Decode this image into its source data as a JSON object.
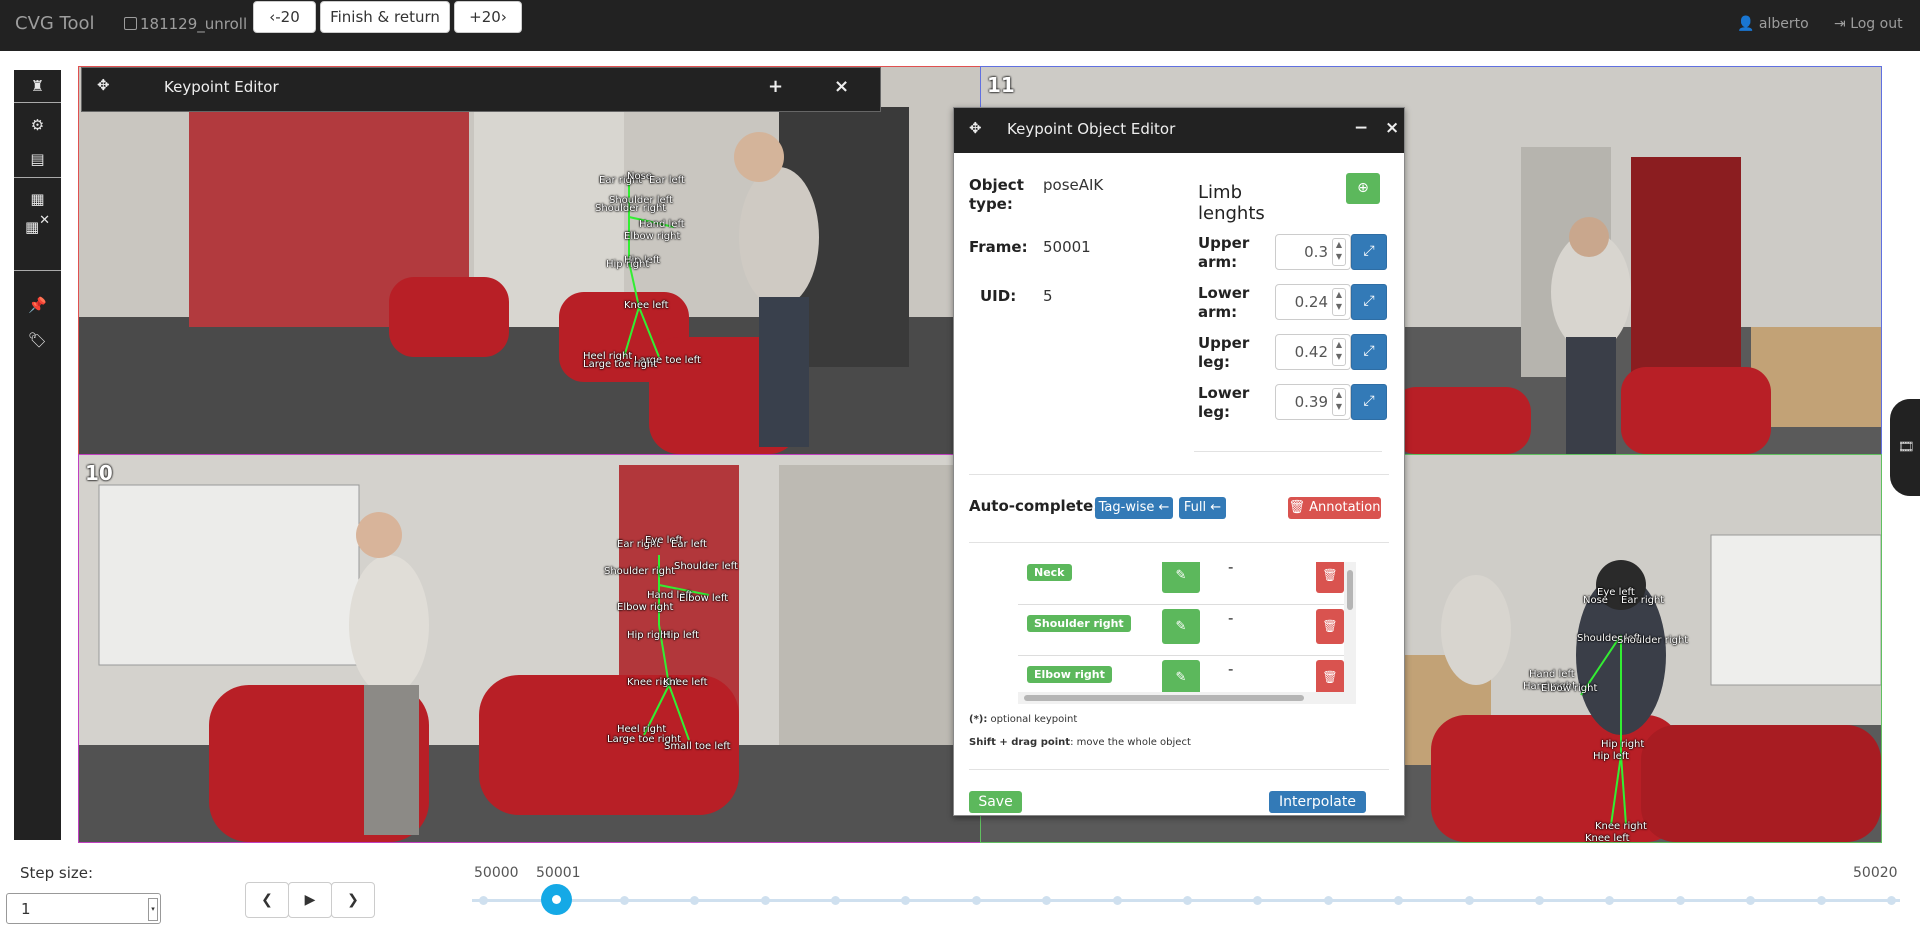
{
  "navbar": {
    "brand": "CVG Tool",
    "video_name": "181129_unroll",
    "prev_label": "‹-20",
    "finish_label": "Finish & return",
    "next_label": "+20›",
    "user_label": "alberto",
    "logout_label": "Log out"
  },
  "sidebar": {
    "tools": [
      "chess-rook-icon",
      "gear-icon",
      "list-icon",
      "grid-icon",
      "grid-close-icon",
      "pin-icon",
      "tag-icon"
    ]
  },
  "cameras": {
    "top_right_label": "11",
    "bottom_left_label": "10"
  },
  "keypoint_editor": {
    "title": "Keypoint Editor",
    "add_label": "+",
    "close_label": "×"
  },
  "object_editor": {
    "title": "Keypoint Object Editor",
    "minimize_label": "−",
    "close_label": "×",
    "object_type_label": "Object type:",
    "object_type_value": "poseAIK",
    "frame_label": "Frame:",
    "frame_value": "50001",
    "uid_label": "UID:",
    "uid_value": "5",
    "limb_title": "Limb lenghts",
    "limbs": [
      {
        "label": "Upper arm:",
        "value": "0.3"
      },
      {
        "label": "Lower arm:",
        "value": "0.24"
      },
      {
        "label": "Upper leg:",
        "value": "0.42"
      },
      {
        "label": "Lower leg:",
        "value": "0.39"
      }
    ],
    "autocomplete_label": "Auto-complete:",
    "tagwise_label": "Tag-wise ←",
    "full_label": "Full ←",
    "annotation_label": "🗑 Annotation",
    "keypoints": [
      {
        "name": "Neck",
        "value": "-"
      },
      {
        "name": "Shoulder right",
        "value": "-"
      },
      {
        "name": "Elbow right",
        "value": "-"
      }
    ],
    "optional_note_bold": "(*):",
    "optional_note": " optional keypoint",
    "shift_note_bold": "Shift + drag point",
    "shift_note": ": move the whole object",
    "save_label": "Save",
    "interpolate_label": "Interpolate"
  },
  "keypoint_labels": {
    "cam_a": [
      "Ear right",
      "Nose",
      "Ear left",
      "Shoulder left",
      "Shoulder right",
      "Hand left",
      "Elbow right",
      "Hip left",
      "Hip right",
      "Knee left",
      "Heel right",
      "Large toe left",
      "Large toe right"
    ],
    "cam_b": [
      "Ear right",
      "Eye left",
      "Ear left",
      "Shoulder right",
      "Shoulder left",
      "Hand left",
      "Elbow left",
      "Elbow right",
      "Hip right",
      "Hip left",
      "Knee right",
      "Knee left",
      "Heel right",
      "Large toe right",
      "Small toe left"
    ],
    "cam_c": [
      "Eye left",
      "Nose",
      "Ear right",
      "Shoulder left",
      "Shoulder right",
      "Hand left",
      "Hand right",
      "Elbow right",
      "Hip right",
      "Hip left",
      "Knee right",
      "Knee left"
    ]
  },
  "bottom": {
    "step_size_label": "Step size:",
    "step_size_value": "1",
    "slider_start": "50000",
    "slider_current": "50001",
    "slider_end": "50020"
  },
  "colors": {
    "navbar": "#222222",
    "primary": "#337ab7",
    "success": "#5cb85c",
    "danger": "#d9534f",
    "slider_knob": "#15a9e6",
    "skeleton": "#33ee33"
  }
}
